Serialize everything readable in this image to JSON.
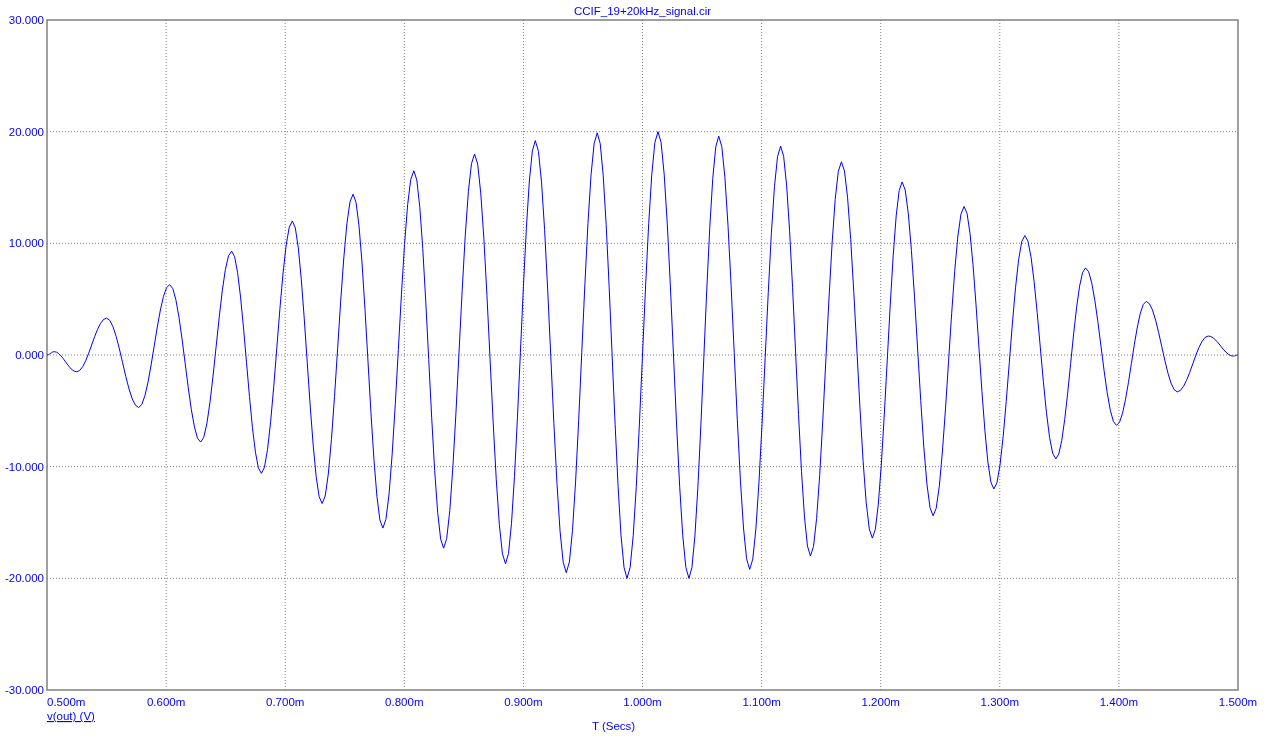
{
  "plot": {
    "chart_data": {
      "type": "line",
      "title": "CCIF_19+20kHz_signal.cir",
      "xlabel": "T (Secs)",
      "grid": true,
      "xlim": [
        0.5,
        1.5
      ],
      "ylim": [
        -30,
        30
      ],
      "xticks": [
        {
          "value": 0.5,
          "label": "0.500m"
        },
        {
          "value": 0.6,
          "label": "0.600m"
        },
        {
          "value": 0.7,
          "label": "0.700m"
        },
        {
          "value": 0.8,
          "label": "0.800m"
        },
        {
          "value": 0.9,
          "label": "0.900m"
        },
        {
          "value": 1.0,
          "label": "1.000m"
        },
        {
          "value": 1.1,
          "label": "1.100m"
        },
        {
          "value": 1.2,
          "label": "1.200m"
        },
        {
          "value": 1.3,
          "label": "1.300m"
        },
        {
          "value": 1.4,
          "label": "1.400m"
        },
        {
          "value": 1.5,
          "label": "1.500m"
        }
      ],
      "yticks": [
        {
          "value": 30,
          "label": "30.000"
        },
        {
          "value": 20,
          "label": "20.000"
        },
        {
          "value": 10,
          "label": "10.000"
        },
        {
          "value": 0,
          "label": "0.000"
        },
        {
          "value": -10,
          "label": "-10.000"
        },
        {
          "value": -20,
          "label": "-20.000"
        },
        {
          "value": -30,
          "label": "-30.000"
        }
      ],
      "x": [
        0.5,
        0.506,
        0.525,
        0.55,
        0.577,
        0.603,
        0.629,
        0.655,
        0.68,
        0.706,
        0.731,
        0.757,
        0.782,
        0.808,
        0.833,
        0.859,
        0.885,
        0.91,
        0.936,
        0.962,
        0.987,
        1.013,
        1.039,
        1.064,
        1.09,
        1.116,
        1.141,
        1.167,
        1.193,
        1.218,
        1.244,
        1.27,
        1.295,
        1.321,
        1.347,
        1.372,
        1.398,
        1.423,
        1.449,
        1.475,
        1.496,
        1.5
      ],
      "series": [
        {
          "name": "v(out) (V)",
          "color": "#0000ff",
          "values": [
            0,
            0.3,
            -1.5,
            3.3,
            -4.7,
            6.3,
            -7.8,
            9.3,
            -10.6,
            12.0,
            -13.3,
            14.4,
            -15.5,
            16.5,
            -17.3,
            18.0,
            -18.7,
            19.2,
            -19.5,
            19.9,
            -20.0,
            20.0,
            -20.0,
            19.6,
            -19.2,
            18.7,
            -18.0,
            17.3,
            -16.4,
            15.5,
            -14.4,
            13.3,
            -12.0,
            10.7,
            -9.3,
            7.8,
            -6.3,
            4.8,
            -3.3,
            1.7,
            -0.1,
            0.0
          ]
        }
      ]
    }
  }
}
